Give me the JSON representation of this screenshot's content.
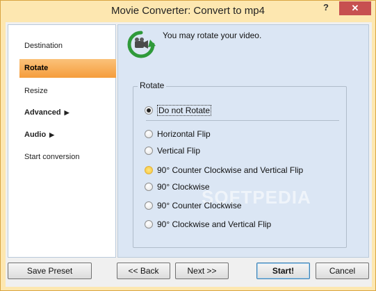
{
  "window": {
    "title": "Movie Converter:  Convert to mp4",
    "help_label": "?",
    "close_label": "✕"
  },
  "sidebar": {
    "items": [
      {
        "label": "Destination"
      },
      {
        "label": "Rotate"
      },
      {
        "label": "Resize"
      },
      {
        "label": "Advanced"
      },
      {
        "label": "Audio"
      },
      {
        "label": "Start conversion"
      }
    ],
    "expand_glyph": "▶"
  },
  "header": {
    "text": "You may rotate your video.",
    "icon": "rotate-video-icon"
  },
  "rotate_group": {
    "legend": "Rotate",
    "selected": "Do not Rotate",
    "options": [
      {
        "label": "Do not Rotate"
      },
      {
        "label": "Horizontal Flip"
      },
      {
        "label": "Vertical Flip"
      },
      {
        "label": "90° Counter Clockwise and Vertical Flip"
      },
      {
        "label": "90° Clockwise"
      },
      {
        "label": "90° Counter Clockwise"
      },
      {
        "label": "90° Clockwise and Vertical Flip"
      }
    ]
  },
  "watermark": "SOFTPEDIA",
  "buttons": {
    "save_preset": "Save Preset",
    "back": "<< Back",
    "next": "Next >>",
    "start": "Start!",
    "cancel": "Cancel"
  },
  "colors": {
    "frame": "#fde7b0",
    "active_nav": "#f59d3c",
    "panel": "#dbe6f4",
    "close_button": "#c75050"
  }
}
